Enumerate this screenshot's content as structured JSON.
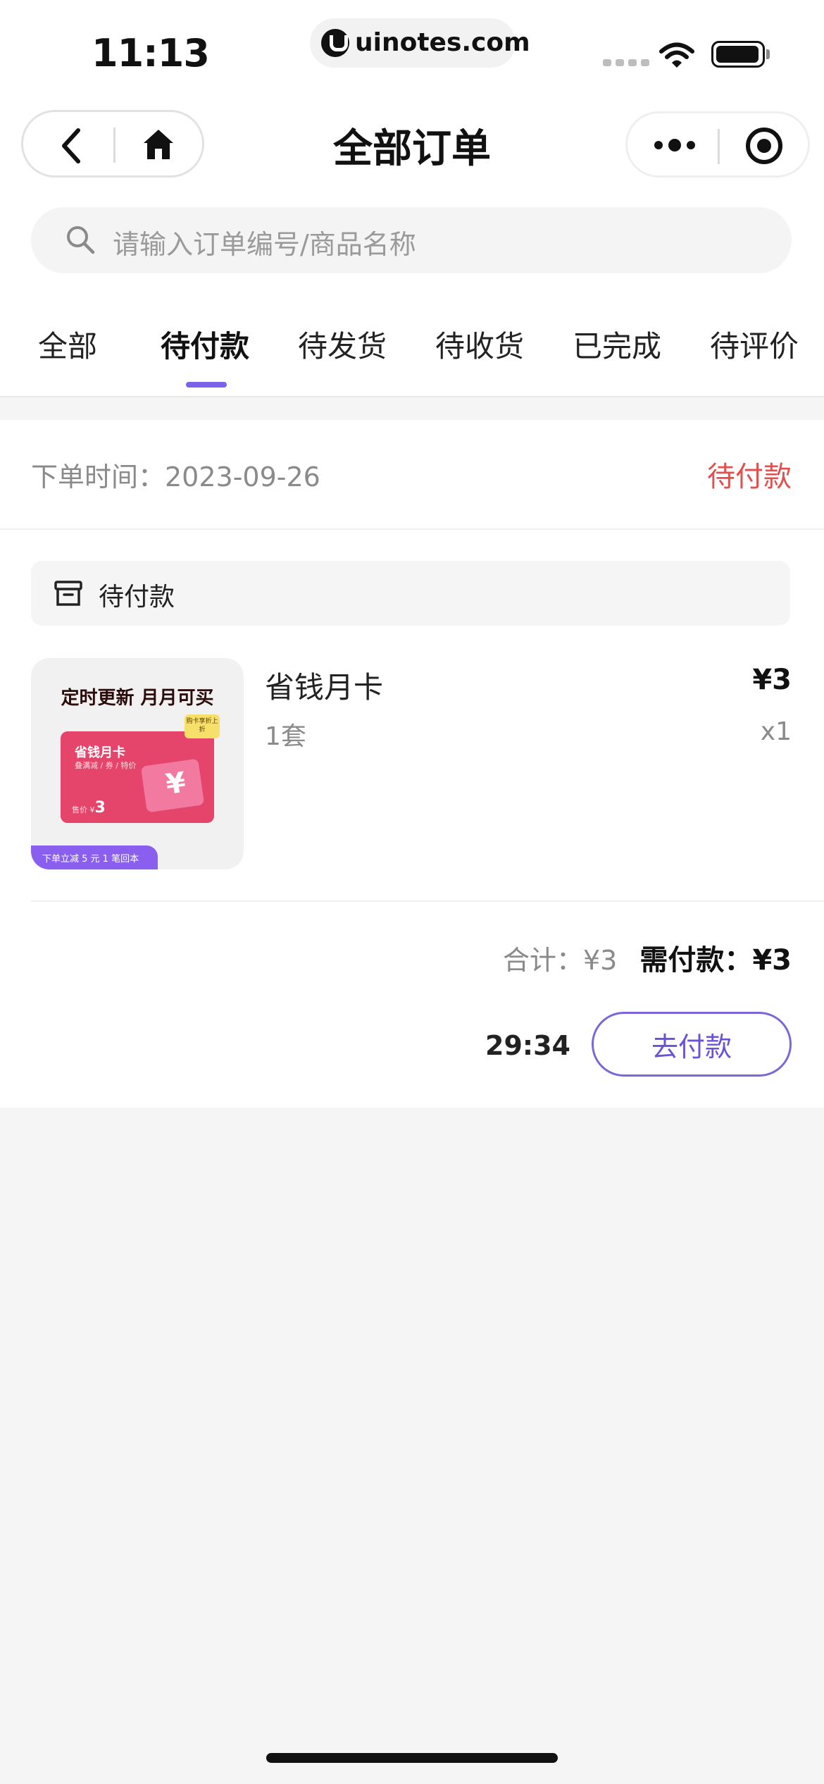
{
  "status_bar": {
    "time": "11:13",
    "url": "uinotes.com",
    "icons": [
      "signal-icon",
      "wifi-icon",
      "battery-icon"
    ]
  },
  "nav": {
    "title": "全部订单",
    "left_icons": [
      "back-icon",
      "home-icon"
    ],
    "right_icons": [
      "more-icon",
      "close-target-icon"
    ]
  },
  "search": {
    "placeholder": "请输入订单编号/商品名称"
  },
  "tabs": [
    {
      "label": "全部",
      "active": false
    },
    {
      "label": "待付款",
      "active": true
    },
    {
      "label": "待发货",
      "active": false
    },
    {
      "label": "待收货",
      "active": false
    },
    {
      "label": "已完成",
      "active": false
    },
    {
      "label": "待评价",
      "active": false
    }
  ],
  "order": {
    "date_label": "下单时间：2023-09-26",
    "status": "待付款",
    "shop_label": "待付款",
    "product": {
      "name": "省钱月卡",
      "spec": "1套",
      "price": "¥3",
      "qty": "x1",
      "image": {
        "headline": "定时更新 月月可买",
        "card_title": "省钱月卡",
        "card_sub": "叠满减 / 券 / 特价",
        "card_price_prefix": "售价 ¥",
        "card_price_value": "3",
        "tag": "购卡享折上折",
        "strip": "下单立减 5 元 1 笔回本"
      }
    },
    "total_label": "合计：¥3",
    "pay_label": "需付款：¥3",
    "countdown": "29:34",
    "pay_button": "去付款"
  },
  "colors": {
    "accent": "#7b62e6",
    "status_red": "#e0504e",
    "background": "#f5f5f5"
  }
}
